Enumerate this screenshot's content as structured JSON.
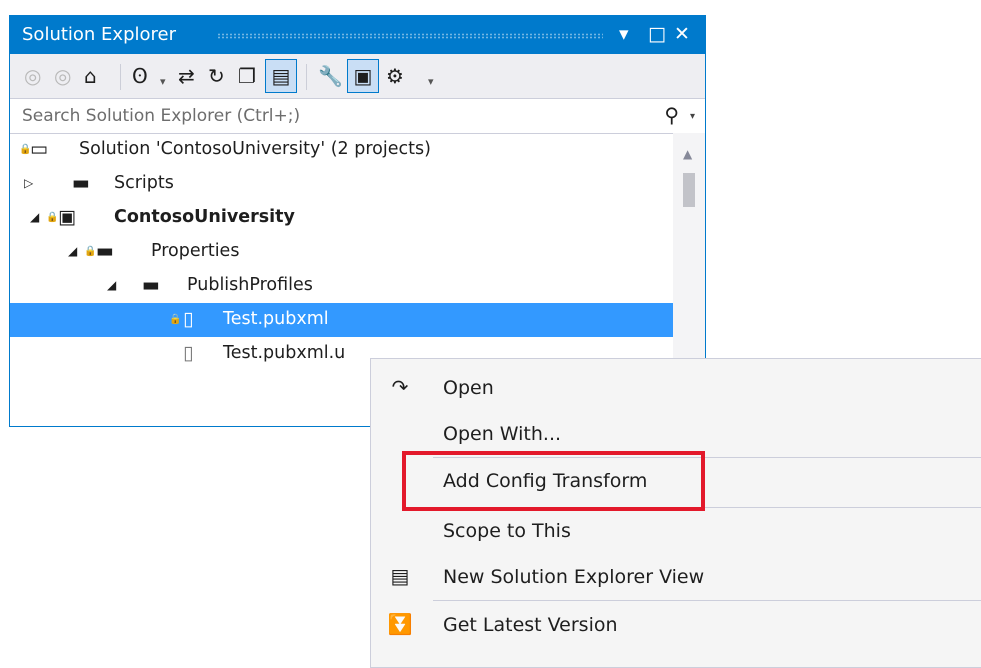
{
  "window": {
    "title": "Solution Explorer",
    "caption_buttons": [
      "▾",
      "□",
      "✕"
    ]
  },
  "toolbar": {
    "icons": [
      "back-icon",
      "forward-icon",
      "home-icon",
      "pending-changes-filter-icon",
      "sync-icon",
      "refresh-icon",
      "collapse-all-icon",
      "show-all-files-icon",
      "properties-icon",
      "preview-selected-items-icon",
      "class-view-icon"
    ]
  },
  "search": {
    "placeholder": "Search Solution Explorer (Ctrl+;)"
  },
  "tree": {
    "items": [
      {
        "label": "Solution 'ContosoUniversity' (2 projects)",
        "icon": "solution-icon"
      },
      {
        "label": "Scripts",
        "icon": "folder-icon"
      },
      {
        "label": "ContosoUniversity",
        "icon": "web-project-icon",
        "bold": true
      },
      {
        "label": "Properties",
        "icon": "properties-folder-icon"
      },
      {
        "label": "PublishProfiles",
        "icon": "folder-icon"
      },
      {
        "label": "Test.pubxml",
        "icon": "file-icon",
        "selected": true
      },
      {
        "label": "Test.pubxml.u",
        "icon": "file-icon"
      }
    ]
  },
  "context_menu": {
    "items": [
      {
        "label": "Open",
        "icon": "open-arrow-icon"
      },
      {
        "label": "Open With..."
      },
      {
        "label": "Add Config Transform",
        "highlighted": true
      },
      {
        "label": "Scope to This"
      },
      {
        "label": "New Solution Explorer View",
        "icon": "new-view-icon"
      },
      {
        "label": "Get Latest Version",
        "icon": "get-latest-icon"
      }
    ]
  },
  "colors": {
    "accent": "#007acc",
    "selection": "#3399ff",
    "highlight_box": "#e3192b"
  }
}
